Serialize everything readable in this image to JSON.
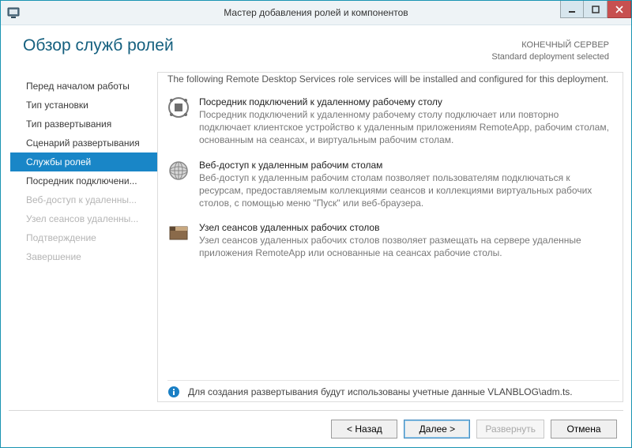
{
  "window": {
    "title": "Мастер добавления ролей и компонентов"
  },
  "header": {
    "page_title": "Обзор служб ролей",
    "server_label": "КОНЕЧНЫЙ СЕРВЕР",
    "deployment_label": "Standard deployment selected"
  },
  "sidebar": {
    "items": [
      {
        "label": "Перед началом работы",
        "state": "normal"
      },
      {
        "label": "Тип установки",
        "state": "normal"
      },
      {
        "label": "Тип развертывания",
        "state": "normal"
      },
      {
        "label": "Сценарий развертывания",
        "state": "normal"
      },
      {
        "label": "Службы ролей",
        "state": "selected"
      },
      {
        "label": "Посредник подключени...",
        "state": "normal"
      },
      {
        "label": "Веб-доступ к удаленны...",
        "state": "disabled"
      },
      {
        "label": "Узел сеансов удаленны...",
        "state": "disabled"
      },
      {
        "label": "Подтверждение",
        "state": "disabled"
      },
      {
        "label": "Завершение",
        "state": "disabled"
      }
    ]
  },
  "content": {
    "intro": "The following Remote Desktop Services role services will be installed and configured for this deployment.",
    "roles": [
      {
        "icon": "broker-icon",
        "title": "Посредник подключений к удаленному рабочему столу",
        "desc": "Посредник подключений к удаленному рабочему столу подключает или повторно подключает клиентское устройство к удаленным приложениям RemoteApp, рабочим столам, основанным на сеансах, и виртуальным рабочим столам."
      },
      {
        "icon": "globe-icon",
        "title": "Веб-доступ к удаленным рабочим столам",
        "desc": "Веб-доступ к удаленным рабочим столам позволяет пользователям подключаться к ресурсам, предоставляемым коллекциями сеансов и коллекциями виртуальных рабочих столов, с помощью меню \"Пуск\" или веб-браузера."
      },
      {
        "icon": "host-icon",
        "title": "Узел сеансов удаленных рабочих столов",
        "desc": "Узел сеансов удаленных рабочих столов позволяет размещать на сервере удаленные приложения RemoteApp или основанные на сеансах рабочие столы."
      }
    ],
    "info_note": "Для создания развертывания будут использованы учетные данные VLANBLOG\\adm.ts."
  },
  "buttons": {
    "back": "< Назад",
    "next": "Далее >",
    "deploy": "Развернуть",
    "cancel": "Отмена"
  }
}
